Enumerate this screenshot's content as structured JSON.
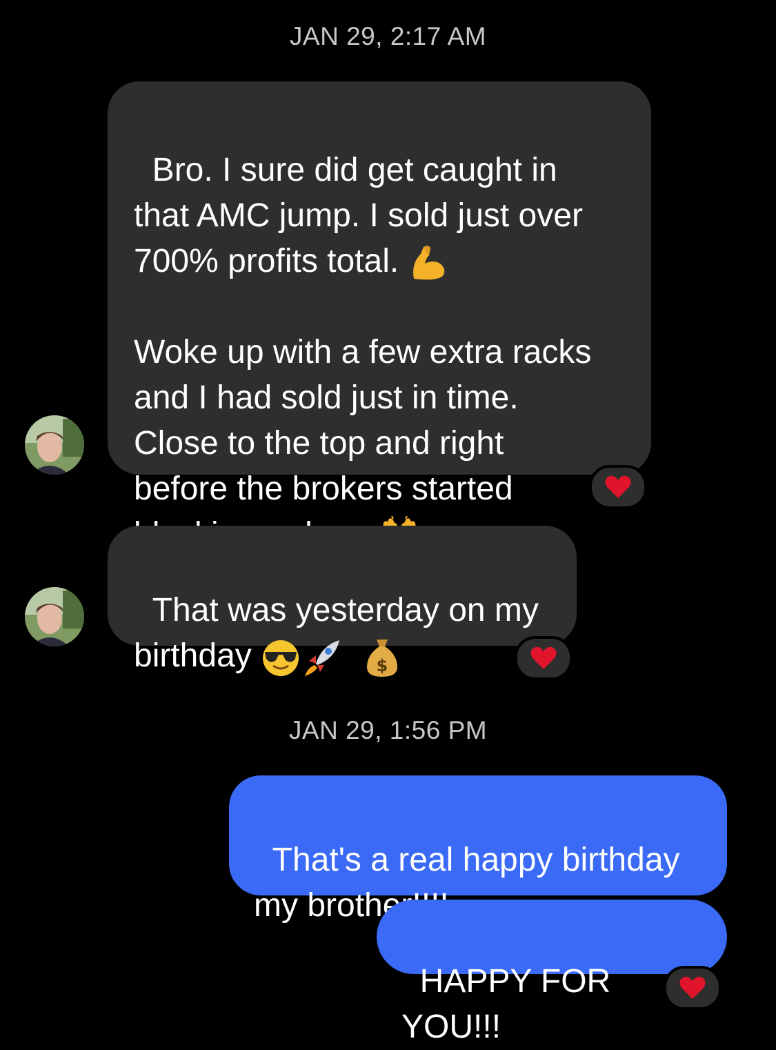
{
  "thread": {
    "timestamp_1": "JAN 29, 2:17 AM",
    "timestamp_2": "JAN 29, 1:56 PM"
  },
  "messages": [
    {
      "direction": "incoming",
      "text": "Bro. I sure did get caught in\nthat AMC jump. I sold just over\n700% profits total. ",
      "text_cont": "Woke up with a few extra racks\nand I had sold just in time.\nClose to the top and right\nbefore the brokers started\nblocking orders. ",
      "emoji_1": "flexed-biceps-icon",
      "emoji_2": "raising-hands-icon",
      "reaction": "heart-icon"
    },
    {
      "direction": "incoming",
      "text": "That was yesterday on my\nbirthday ",
      "emojis": [
        "smiling-sunglasses-icon",
        "rocket-icon",
        "money-bag-icon"
      ],
      "reaction": "heart-icon"
    },
    {
      "direction": "outgoing",
      "text": "That's a real happy birthday\nmy brother!!!!"
    },
    {
      "direction": "outgoing",
      "text": "HAPPY FOR YOU!!!",
      "reaction": "heart-icon"
    }
  ],
  "colors": {
    "background": "#000000",
    "incoming_bubble": "#2e2e2e",
    "outgoing_bubble": "#3a6af6",
    "timestamp": "#c8c8c8",
    "heart": "#e0142b"
  }
}
